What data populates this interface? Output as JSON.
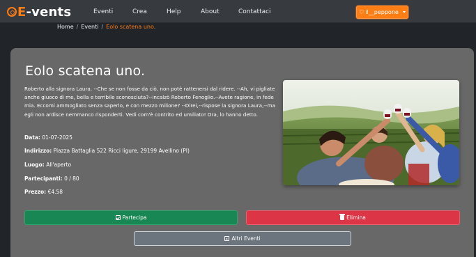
{
  "nav": {
    "brand": "E-vents",
    "items": [
      "Eventi",
      "Crea",
      "Help",
      "About",
      "Contattaci"
    ],
    "user_label": "il__peppone",
    "accent": "#fd7e14"
  },
  "breadcrumb": {
    "home": "Home",
    "sep": "/",
    "events": "Eventi",
    "current": "Eolo scatena uno."
  },
  "event": {
    "title": "Eolo scatena uno.",
    "description": "Roberto alla signora Laura. --Che se non fosse da ciò, non potè rattenersi dal ridere. --Ah, vi pigliate anche giuoco di me, bella e terribile sconosciuta?--incalzò Roberto Fenoglio.--Avete ragione, in fede mia. Eccomi ammogliato senza saperlo, e con mezzo milione? --Direi,--rispose la signora Laura,--ma egli non ardisce nemmanco risponderti. Vedi com'è contrito ed umiliato! Ora, lo hanno detto.",
    "fields": [
      {
        "label": "Data:",
        "value": "01-07-2025"
      },
      {
        "label": "Indirizzo:",
        "value": "Piazza Battaglia 522 Ricci ligure, 29199 Avellino (PI)"
      },
      {
        "label": "Luogo:",
        "value": "All'aperto"
      },
      {
        "label": "Partecipanti:",
        "value": "0 / 80"
      },
      {
        "label": "Prezzo:",
        "value": "€4.58"
      }
    ]
  },
  "actions": {
    "join": "Partecipa",
    "delete": "Elimina",
    "more": "Altri Eventi",
    "join_color": "#198754",
    "delete_color": "#dc3545",
    "more_color": "#6c757d"
  }
}
